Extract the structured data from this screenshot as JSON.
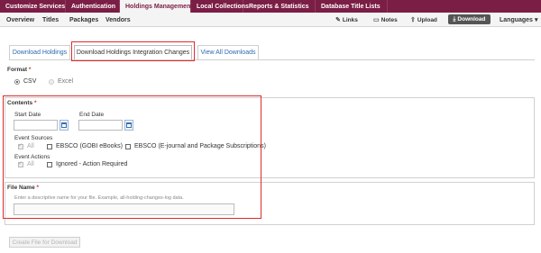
{
  "top_nav": [
    {
      "label": "Customize Services"
    },
    {
      "label": "Authentication"
    },
    {
      "label": "Holdings Management"
    },
    {
      "label": "Local Collections"
    },
    {
      "label": "Reports & Statistics"
    },
    {
      "label": "Database Title Lists"
    }
  ],
  "sub_nav": {
    "items": [
      {
        "label": "Overview"
      },
      {
        "label": "Titles"
      },
      {
        "label": "Packages"
      },
      {
        "label": "Vendors"
      }
    ],
    "actions": {
      "links": "Links",
      "notes": "Notes",
      "upload": "Upload",
      "download": "Download",
      "languages": "Languages"
    }
  },
  "tabs": [
    {
      "label": "Download Holdings"
    },
    {
      "label": "Download Holdings Integration Changes"
    },
    {
      "label": "View All Downloads"
    }
  ],
  "format": {
    "label": "Format",
    "required_mark": "*",
    "options": [
      {
        "label": "CSV",
        "selected": true
      },
      {
        "label": "Excel",
        "selected": false
      }
    ]
  },
  "contents": {
    "label": "Contents",
    "required_mark": "*",
    "start_date_label": "Start Date",
    "end_date_label": "End Date",
    "event_sources_label": "Event Sources",
    "event_sources": {
      "all": "All",
      "gobi": "EBSCO (GOBI eBooks)",
      "ejournal": "EBSCO (E-journal and Package Subscriptions)"
    },
    "event_actions_label": "Event Actions",
    "event_actions": {
      "all": "All",
      "ignored": "Ignored - Action Required"
    }
  },
  "file_name": {
    "label": "File Name",
    "required_mark": "*",
    "hint": "Enter a descriptive name for your file. Example, all-holding-changes-log data.",
    "value": ""
  },
  "create_button": "Create File for Download"
}
